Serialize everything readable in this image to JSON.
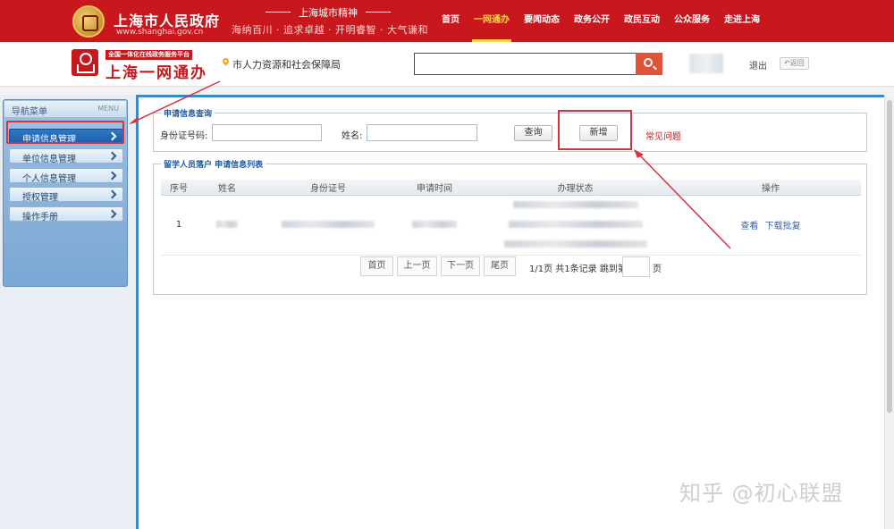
{
  "header": {
    "gov_title": "上海市人民政府",
    "gov_url": "www.shanghai.gov.cn",
    "spirit_title": "上海城市精神",
    "spirit_text": "海纳百川 · 追求卓越 · 开明睿智 · 大气谦和",
    "nav": [
      {
        "label": "首页",
        "active": false
      },
      {
        "label": "一网通办",
        "active": true
      },
      {
        "label": "要闻动态",
        "active": false
      },
      {
        "label": "政务公开",
        "active": false
      },
      {
        "label": "政民互动",
        "active": false
      },
      {
        "label": "公众服务",
        "active": false
      },
      {
        "label": "走进上海",
        "active": false
      }
    ]
  },
  "subheader": {
    "platform_tag": "全国一体化在线政务服务平台",
    "platform_name": "上海一网通办",
    "department": "市人力资源和社会保障局",
    "search_placeholder": "",
    "logout": "退出",
    "back": "返回"
  },
  "sidebar": {
    "title": "导航菜单",
    "title_en": "MENU",
    "items": [
      {
        "label": "申请信息管理",
        "active": true
      },
      {
        "label": "单位信息管理",
        "active": false
      },
      {
        "label": "个人信息管理",
        "active": false
      },
      {
        "label": "授权管理",
        "active": false
      },
      {
        "label": "操作手册",
        "active": false
      }
    ]
  },
  "query": {
    "legend": "申请信息查询",
    "id_label": "身份证号码:",
    "id_value": "",
    "name_label": "姓名:",
    "name_value": "",
    "query_button": "查询",
    "add_button": "新增",
    "faq_link": "常见问题"
  },
  "list": {
    "legend_prefix": "留学人员落户",
    "legend_suffix": "申请信息列表",
    "columns": [
      "序号",
      "姓名",
      "身份证号",
      "申请时间",
      "办理状态",
      "操作"
    ],
    "rows": [
      {
        "index": "1",
        "actions": [
          "查看",
          "下载批复"
        ]
      }
    ]
  },
  "pager": {
    "first": "首页",
    "prev": "上一页",
    "next": "下一页",
    "last": "尾页",
    "summary": "1/1页 共1条记录 跳到第",
    "page_suffix": "页"
  },
  "watermark": "知乎 @初心联盟",
  "colors": {
    "brand_red": "#c8171d",
    "nav_blue": "#1a5ea8",
    "annotation_red": "#d8323c"
  }
}
